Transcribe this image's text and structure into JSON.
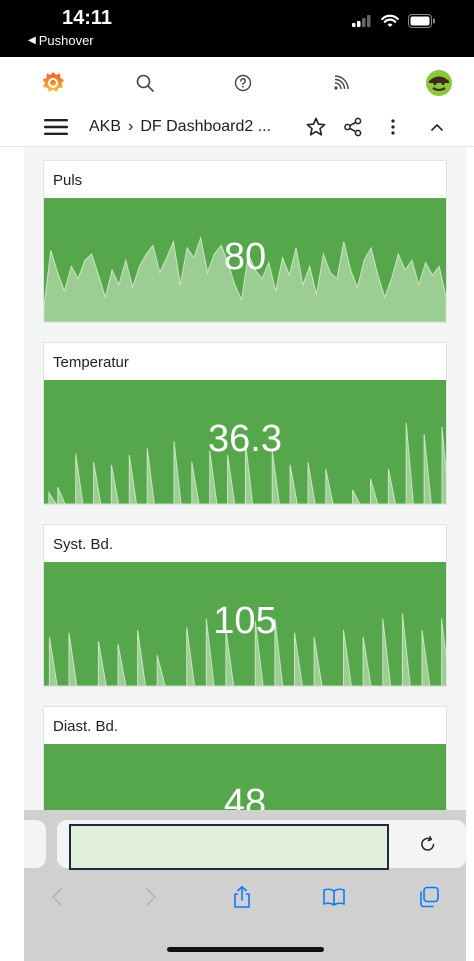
{
  "status_bar": {
    "time": "14:11",
    "back_app": "Pushover",
    "back_glyph": "◀"
  },
  "app_bar": {
    "icons": [
      "grafana-logo-icon",
      "search-icon",
      "help-icon",
      "rss-feed-icon",
      "user-avatar-icon"
    ]
  },
  "breadcrumb": {
    "folder": "AKB",
    "separator": "›",
    "dashboard": "DF Dashboard2 ..."
  },
  "panels": [
    {
      "title": "Puls",
      "value": "80",
      "chart_style": "area",
      "series": [
        12,
        58,
        40,
        25,
        45,
        35,
        50,
        55,
        38,
        20,
        42,
        30,
        50,
        28,
        45,
        55,
        62,
        40,
        52,
        65,
        30,
        60,
        52,
        68,
        40,
        55,
        62,
        48,
        30,
        18,
        55,
        42,
        35,
        48,
        25,
        52,
        38,
        60,
        30,
        45,
        22,
        55,
        40,
        35,
        65,
        42,
        28,
        50,
        60,
        38,
        20,
        35,
        55,
        42,
        50,
        30,
        48,
        38,
        45,
        20
      ]
    },
    {
      "title": "Temperatur",
      "value": "36.3",
      "chart_style": "spikes",
      "series": [
        0,
        8,
        12,
        0,
        36,
        0,
        30,
        0,
        28,
        0,
        35,
        0,
        40,
        0,
        0,
        45,
        0,
        30,
        0,
        38,
        0,
        35,
        0,
        45,
        0,
        0,
        38,
        0,
        28,
        0,
        30,
        0,
        25,
        0,
        0,
        10,
        0,
        18,
        0,
        25,
        0,
        58,
        0,
        50,
        0,
        55
      ]
    },
    {
      "title": "Syst. Bd.",
      "value": "105",
      "chart_style": "spikes",
      "series": [
        0,
        35,
        0,
        38,
        0,
        0,
        32,
        0,
        30,
        0,
        40,
        0,
        22,
        0,
        0,
        42,
        0,
        48,
        0,
        40,
        0,
        0,
        46,
        0,
        48,
        0,
        38,
        0,
        35,
        0,
        0,
        40,
        0,
        35,
        0,
        48,
        0,
        52,
        0,
        40,
        0,
        48
      ]
    },
    {
      "title": "Diast. Bd.",
      "value": "48",
      "chart_style": "spikes",
      "series": [
        0,
        0,
        0,
        0,
        0,
        0,
        0,
        0,
        0,
        0,
        0,
        0,
        0,
        0,
        0,
        0,
        0,
        0,
        0,
        0,
        0,
        0,
        0,
        0,
        0,
        0,
        0,
        0,
        0,
        0,
        0,
        0,
        0,
        0,
        0,
        0,
        0,
        0,
        0,
        0,
        12,
        0
      ]
    }
  ],
  "colors": {
    "panel_green": "#56a64b",
    "sparkline_fill": "#a8d5a0",
    "sparkline_stroke": "#c9e6c3",
    "url_field_bg": "#e2efdb",
    "url_field_border": "#1b2a47",
    "safari_blue": "#0a7aff"
  },
  "safari": {
    "url_value": "",
    "toolbar_icons": [
      "back-arrow-icon",
      "forward-arrow-icon",
      "share-icon",
      "bookmarks-icon",
      "tabs-icon"
    ]
  }
}
